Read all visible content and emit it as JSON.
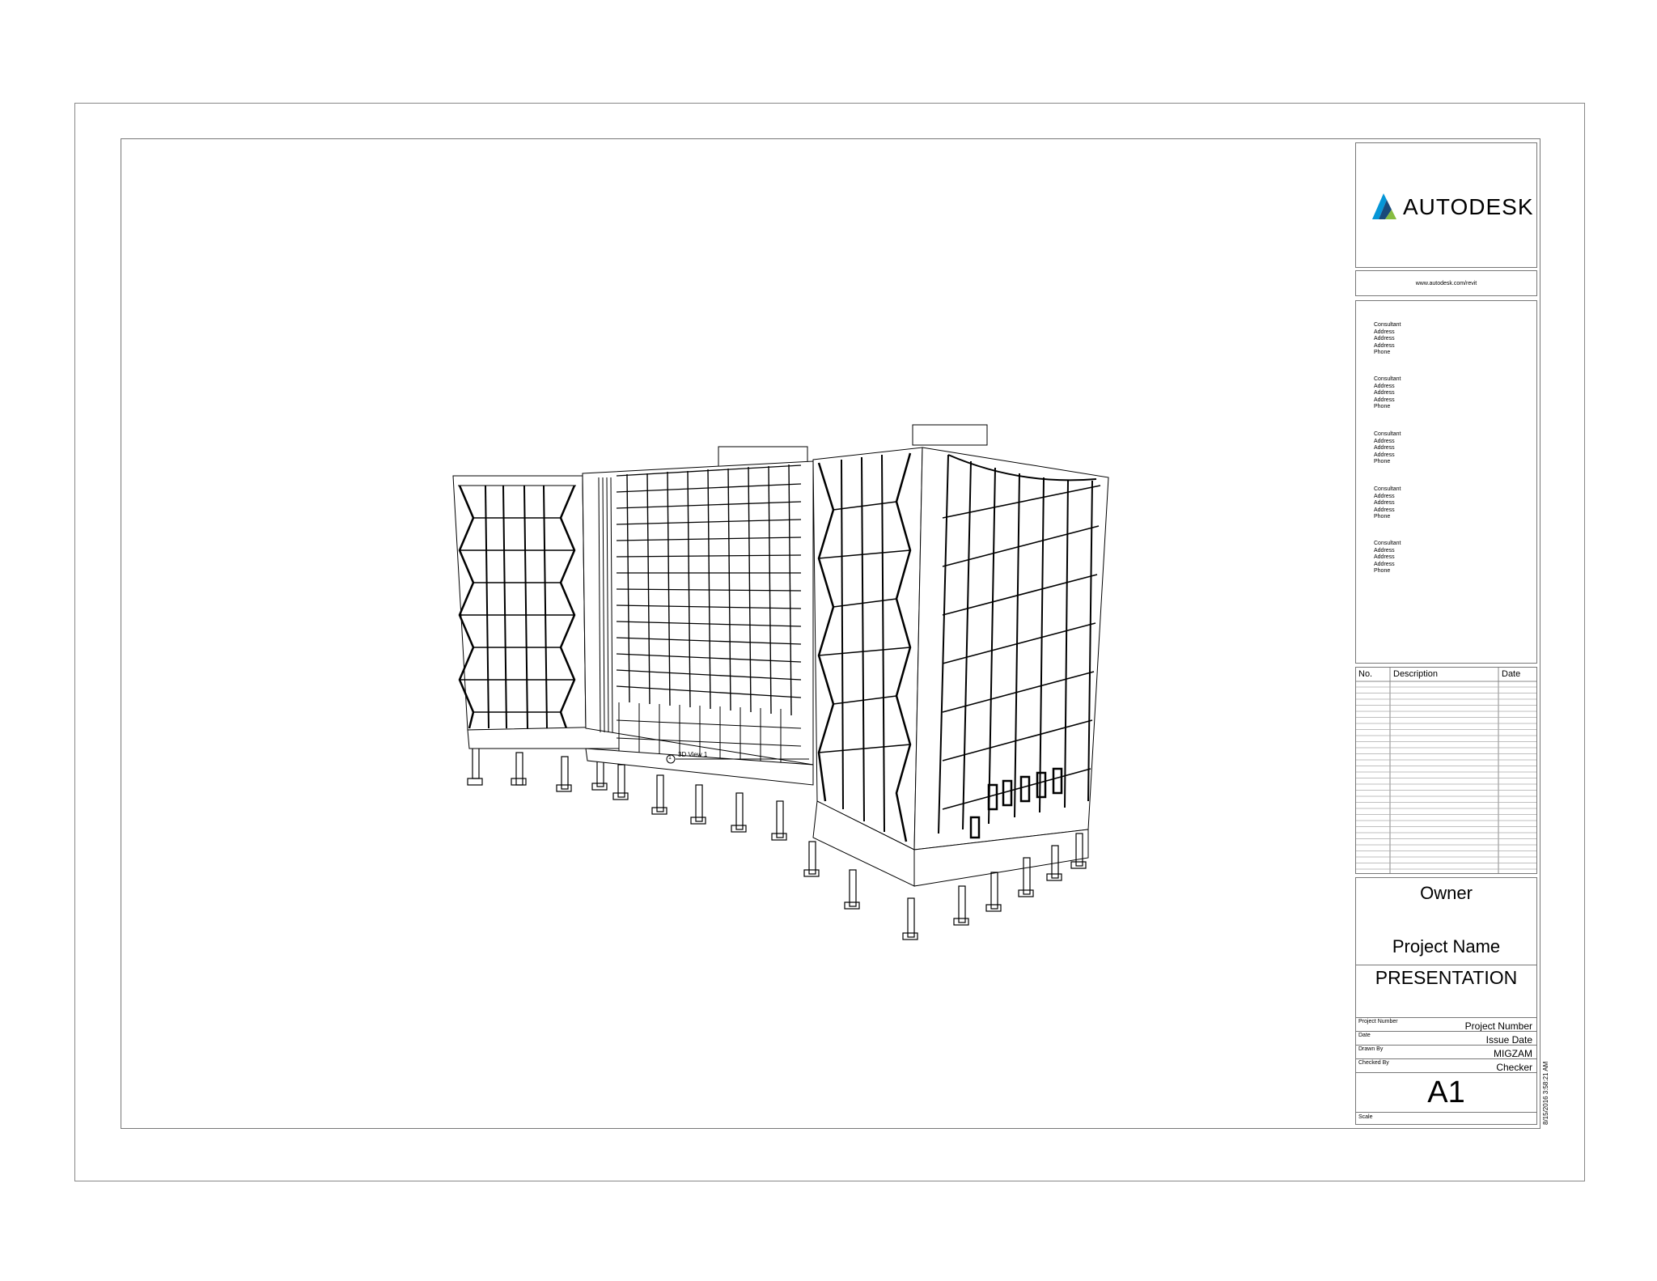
{
  "brand": {
    "logo_text": "AUTODESK",
    "logo_colors": [
      "#0696d7",
      "#1a4a7a",
      "#87bc40"
    ],
    "website": "www.autodesk.com/revit"
  },
  "consultants": [
    {
      "lines": [
        "Consultant",
        "Address",
        "Address",
        "Address",
        "Phone"
      ]
    },
    {
      "lines": [
        "Consultant",
        "Address",
        "Address",
        "Address",
        "Phone"
      ]
    },
    {
      "lines": [
        "Consultant",
        "Address",
        "Address",
        "Address",
        "Phone"
      ]
    },
    {
      "lines": [
        "Consultant",
        "Address",
        "Address",
        "Address",
        "Phone"
      ]
    },
    {
      "lines": [
        "Consultant",
        "Address",
        "Address",
        "Address",
        "Phone"
      ]
    }
  ],
  "revisions": {
    "col_no": "No.",
    "col_description": "Description",
    "col_date": "Date"
  },
  "title_block": {
    "owner": "Owner",
    "project_name": "Project Name",
    "sheet_name": "PRESENTATION",
    "fields": [
      {
        "label": "Project Number",
        "value": "Project Number"
      },
      {
        "label": "Date",
        "value": "Issue Date"
      },
      {
        "label": "Drawn By",
        "value": "MIGZAM"
      },
      {
        "label": "Checked By",
        "value": "Checker"
      }
    ],
    "sheet_number": "A1",
    "scale_label": "Scale"
  },
  "view": {
    "callout_number": "1",
    "title": "3D View 1"
  },
  "timestamp": "8/15/2016 3:58:21 AM"
}
